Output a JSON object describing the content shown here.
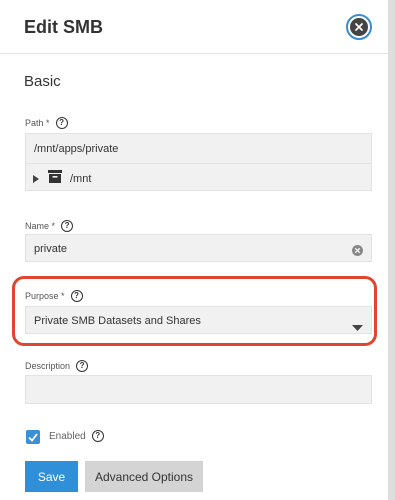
{
  "header": {
    "title": "Edit SMB"
  },
  "section": {
    "title": "Basic"
  },
  "path": {
    "label": "Path *",
    "value": "/mnt/apps/private",
    "tree_item": "/mnt"
  },
  "name": {
    "label": "Name *",
    "value": "private"
  },
  "purpose": {
    "label": "Purpose *",
    "value": "Private SMB Datasets and Shares"
  },
  "description": {
    "label": "Description",
    "value": ""
  },
  "enabled": {
    "label": "Enabled",
    "checked": true
  },
  "buttons": {
    "save": "Save",
    "advanced": "Advanced Options"
  },
  "help_glyph": "?",
  "colors": {
    "accent": "#2f8fd8",
    "highlight": "#e0452f"
  }
}
